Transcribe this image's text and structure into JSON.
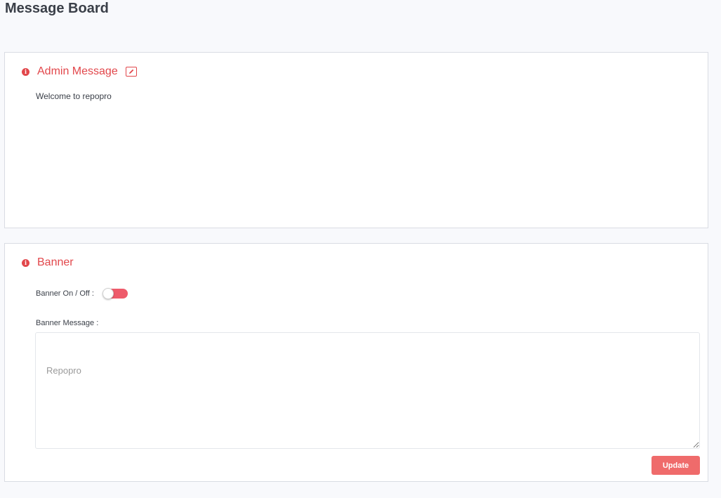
{
  "page": {
    "title": "Message Board"
  },
  "admin_message": {
    "heading": "Admin Message",
    "text": "Welcome to repopro",
    "icons": [
      "info-icon",
      "edit-icon"
    ]
  },
  "banner": {
    "heading": "Banner",
    "toggle_label": "Banner On / Off :",
    "toggle_on": false,
    "message_label": "Banner Message :",
    "message_placeholder": "Repopro",
    "update_label": "Update"
  },
  "colors": {
    "accent": "#e2474b",
    "toggle": "#ee5b6b",
    "button": "#ef6b6b",
    "background": "#f8f9fc"
  }
}
